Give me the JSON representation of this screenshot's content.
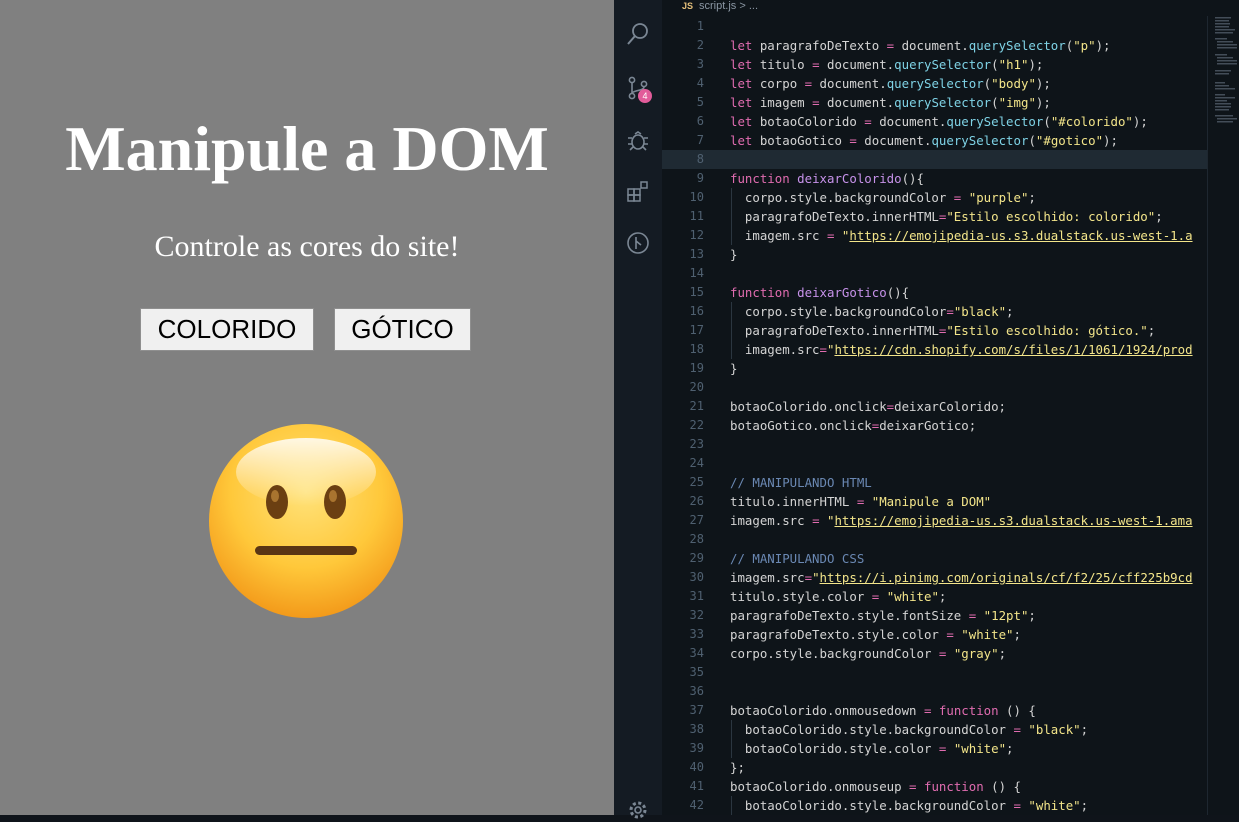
{
  "preview": {
    "title": "Manipule a DOM",
    "subtitle": "Controle as cores do site!",
    "buttons": {
      "colorido": "COLORIDO",
      "gotico": "GÓTICO"
    }
  },
  "editor": {
    "tab": {
      "lang_badge": "JS",
      "filename": "script.js",
      "breadcrumb_rest": "> ..."
    },
    "scm_badge": "4",
    "current_line": 8,
    "lines": [
      {
        "n": "1",
        "html": ""
      },
      {
        "n": "2",
        "html": "<span class='k'>let</span> paragrafoDeTexto <span class='o'>=</span> document.<span class='m'>querySelector</span>(<span class='s'>\"p\"</span>);"
      },
      {
        "n": "3",
        "html": "<span class='k'>let</span> titulo <span class='o'>=</span> document.<span class='m'>querySelector</span>(<span class='s'>\"h1\"</span>);"
      },
      {
        "n": "4",
        "html": "<span class='k'>let</span> corpo <span class='o'>=</span> document.<span class='m'>querySelector</span>(<span class='s'>\"body\"</span>);"
      },
      {
        "n": "5",
        "html": "<span class='k'>let</span> imagem <span class='o'>=</span> document.<span class='m'>querySelector</span>(<span class='s'>\"img\"</span>);"
      },
      {
        "n": "6",
        "html": "<span class='k'>let</span> botaoColorido <span class='o'>=</span> document.<span class='m'>querySelector</span>(<span class='s'>\"#colorido\"</span>);"
      },
      {
        "n": "7",
        "html": "<span class='k'>let</span> botaoGotico <span class='o'>=</span> document.<span class='m'>querySelector</span>(<span class='s'>\"#gotico\"</span>);"
      },
      {
        "n": "8",
        "html": ""
      },
      {
        "n": "9",
        "html": "<span class='k'>function</span> <span class='f'>deixarColorido</span>(){"
      },
      {
        "n": "10",
        "html": "  corpo.style.backgroundColor <span class='o'>=</span> <span class='s'>\"purple\"</span>;"
      },
      {
        "n": "11",
        "html": "  paragrafoDeTexto.innerHTML<span class='o'>=</span><span class='s'>\"Estilo escolhido: colorido\"</span>;"
      },
      {
        "n": "12",
        "html": "  imagem.src <span class='o'>=</span> <span class='s'>\"</span><span class='u'>https://emojipedia-us.s3.dualstack.us-west-1.a</span>"
      },
      {
        "n": "13",
        "html": "}"
      },
      {
        "n": "14",
        "html": ""
      },
      {
        "n": "15",
        "html": "<span class='k'>function</span> <span class='f'>deixarGotico</span>(){"
      },
      {
        "n": "16",
        "html": "  corpo.style.backgroundColor<span class='o'>=</span><span class='s'>\"black\"</span>;"
      },
      {
        "n": "17",
        "html": "  paragrafoDeTexto.innerHTML<span class='o'>=</span><span class='s'>\"Estilo escolhido: gótico.\"</span>;"
      },
      {
        "n": "18",
        "html": "  imagem.src<span class='o'>=</span><span class='s'>\"</span><span class='u'>https://cdn.shopify.com/s/files/1/1061/1924/prod</span>"
      },
      {
        "n": "19",
        "html": "}"
      },
      {
        "n": "20",
        "html": ""
      },
      {
        "n": "21",
        "html": "botaoColorido.onclick<span class='o'>=</span>deixarColorido;"
      },
      {
        "n": "22",
        "html": "botaoGotico.onclick<span class='o'>=</span>deixarGotico;"
      },
      {
        "n": "23",
        "html": ""
      },
      {
        "n": "24",
        "html": ""
      },
      {
        "n": "25",
        "html": "<span class='c'>// MANIPULANDO HTML</span>"
      },
      {
        "n": "26",
        "html": "titulo.innerHTML <span class='o'>=</span> <span class='s'>\"Manipule a DOM\"</span>"
      },
      {
        "n": "27",
        "html": "imagem.src <span class='o'>=</span> <span class='s'>\"</span><span class='u'>https://emojipedia-us.s3.dualstack.us-west-1.ama</span>"
      },
      {
        "n": "28",
        "html": ""
      },
      {
        "n": "29",
        "html": "<span class='c'>// MANIPULANDO CSS</span>"
      },
      {
        "n": "30",
        "html": "imagem.src<span class='o'>=</span><span class='s'>\"</span><span class='u'>https://i.pinimg.com/originals/cf/f2/25/cff225b9cd</span>"
      },
      {
        "n": "31",
        "html": "titulo.style.color <span class='o'>=</span> <span class='s'>\"white\"</span>;"
      },
      {
        "n": "32",
        "html": "paragrafoDeTexto.style.fontSize <span class='o'>=</span> <span class='s'>\"12pt\"</span>;"
      },
      {
        "n": "33",
        "html": "paragrafoDeTexto.style.color <span class='o'>=</span> <span class='s'>\"white\"</span>;"
      },
      {
        "n": "34",
        "html": "corpo.style.backgroundColor <span class='o'>=</span> <span class='s'>\"gray\"</span>;"
      },
      {
        "n": "35",
        "html": ""
      },
      {
        "n": "36",
        "html": ""
      },
      {
        "n": "37",
        "html": "botaoColorido.onmousedown <span class='o'>=</span> <span class='k'>function</span> () {"
      },
      {
        "n": "38",
        "html": "  botaoColorido.style.backgroundColor <span class='o'>=</span> <span class='s'>\"black\"</span>;"
      },
      {
        "n": "39",
        "html": "  botaoColorido.style.color <span class='o'>=</span> <span class='s'>\"white\"</span>;"
      },
      {
        "n": "40",
        "html": "};"
      },
      {
        "n": "41",
        "html": "botaoColorido.onmouseup <span class='o'>=</span> <span class='k'>function</span> () {"
      },
      {
        "n": "42",
        "html": "  botaoColorido.style.backgroundColor <span class='o'>=</span> <span class='s'>\"white\"</span>;"
      }
    ],
    "indented_lines": [
      10,
      11,
      12,
      16,
      17,
      18,
      38,
      39,
      42
    ]
  }
}
